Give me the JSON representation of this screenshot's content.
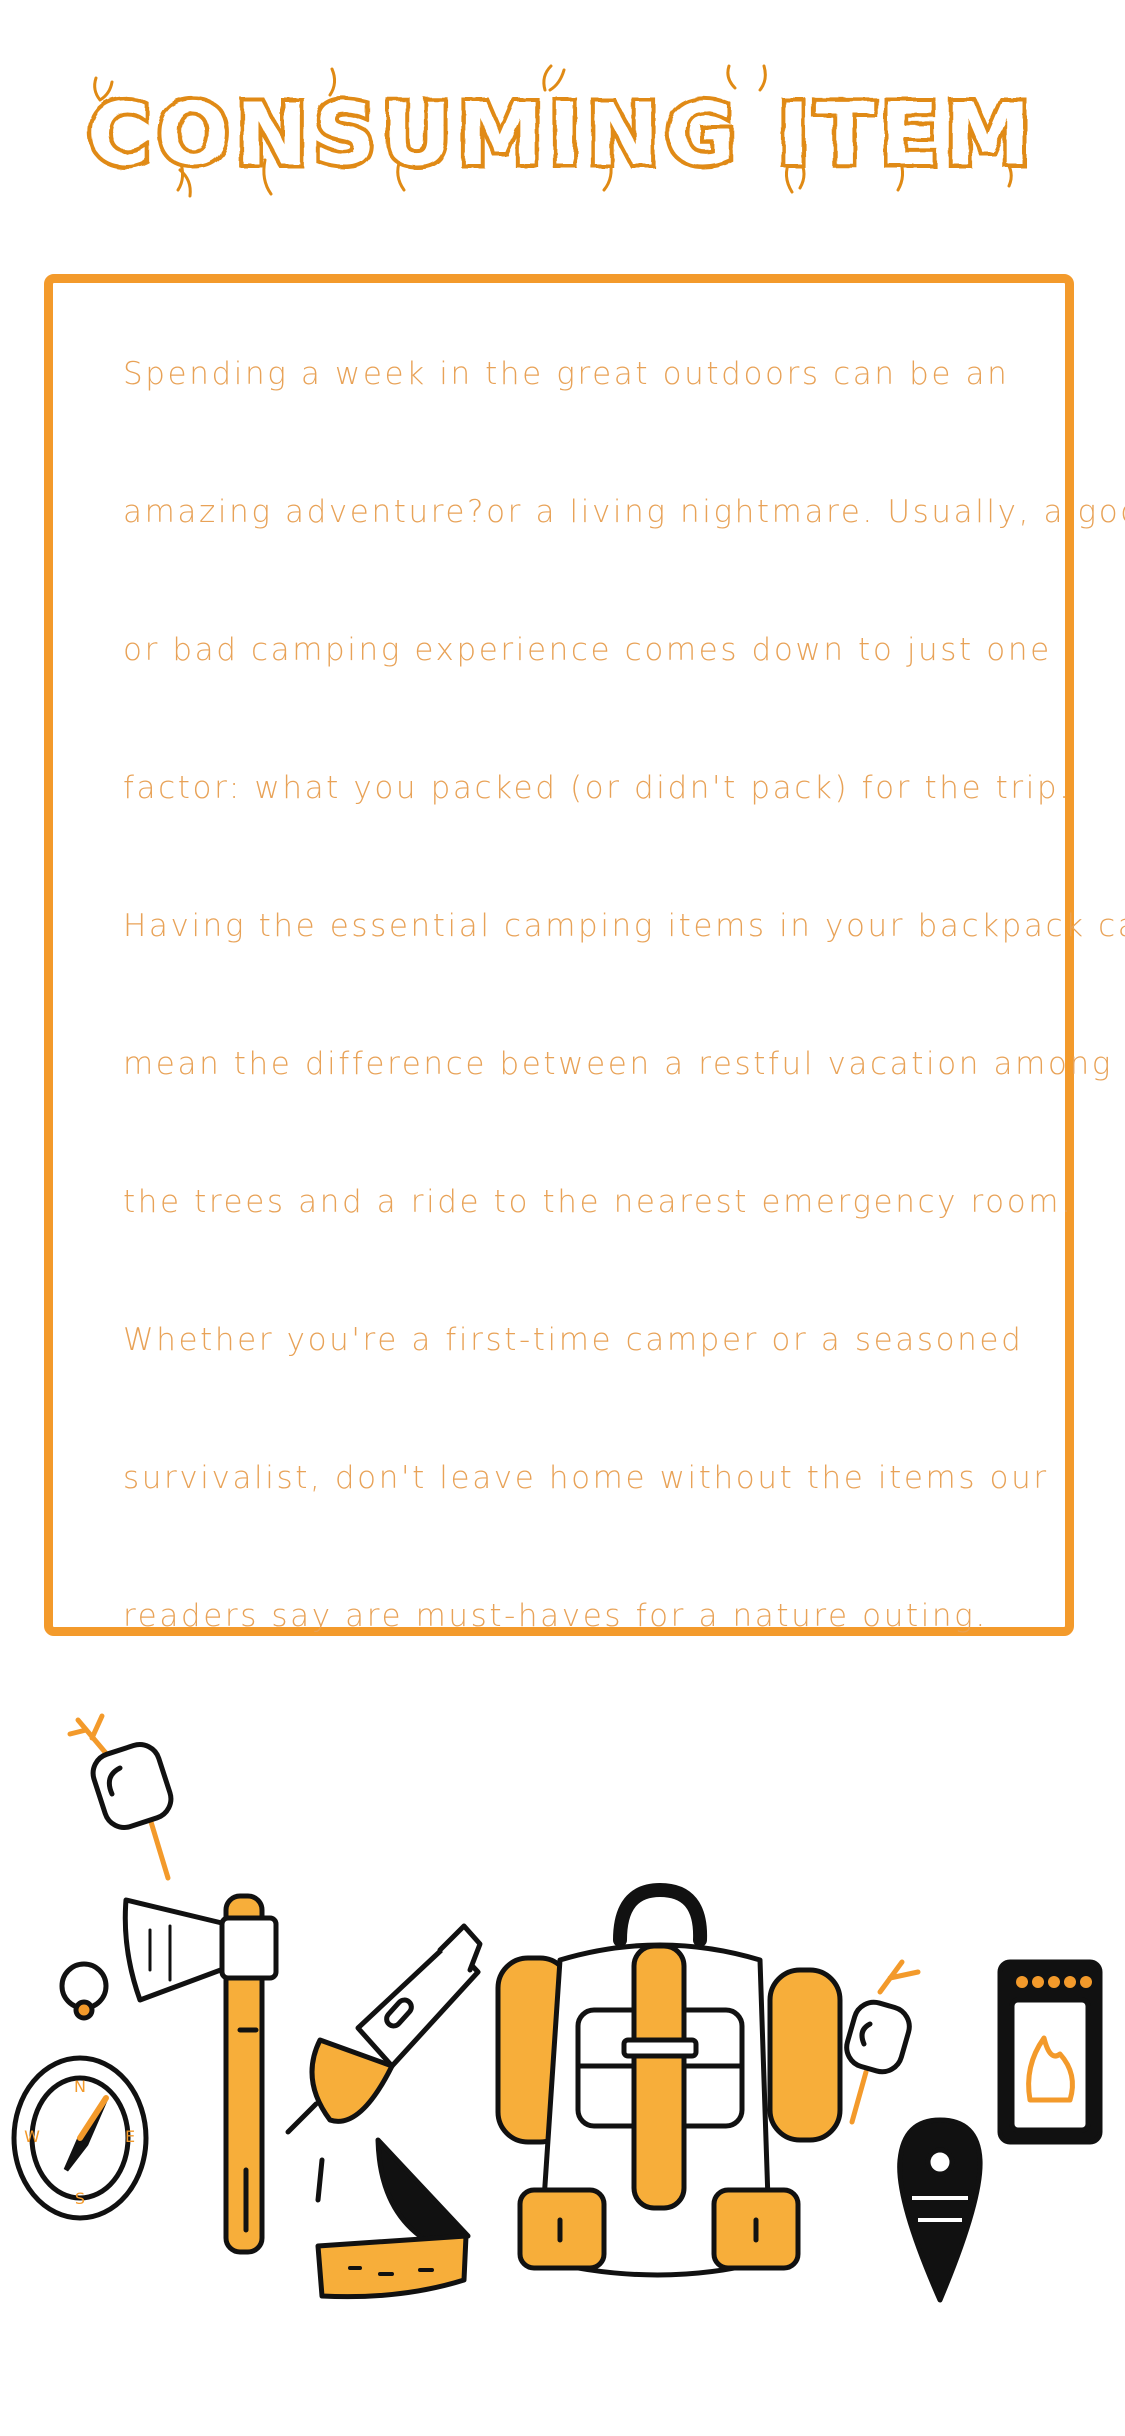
{
  "colors": {
    "accent": "#F39A2B",
    "text": "#E8A257",
    "title": "#E08A14",
    "ink": "#111111"
  },
  "title": "CONSUMING ITEM",
  "paragraph_lines": [
    "Spending a week in the great outdoors can be an",
    "amazing adventure?or a living nightmare. Usually, a good",
    "or bad camping experience comes down to just one",
    "factor: what you packed (or didn't pack) for the trip.",
    "Having the essential camping items in your backpack can",
    "mean the difference between a restful vacation among",
    "the trees and a ride to the nearest emergency room.",
    "Whether you're a first-time camper or a seasoned",
    "survivalist, don't leave home without the items our",
    "readers say are must-haves for a nature outing."
  ],
  "illustration": {
    "items": [
      "marshmallow-stick-icon",
      "axe-icon",
      "compass-icon",
      "flashlight-icon",
      "knife-icon",
      "backpack-icon",
      "map-pin-icon",
      "matchbox-icon"
    ],
    "compass_letters": [
      "N",
      "E",
      "S",
      "W"
    ]
  }
}
